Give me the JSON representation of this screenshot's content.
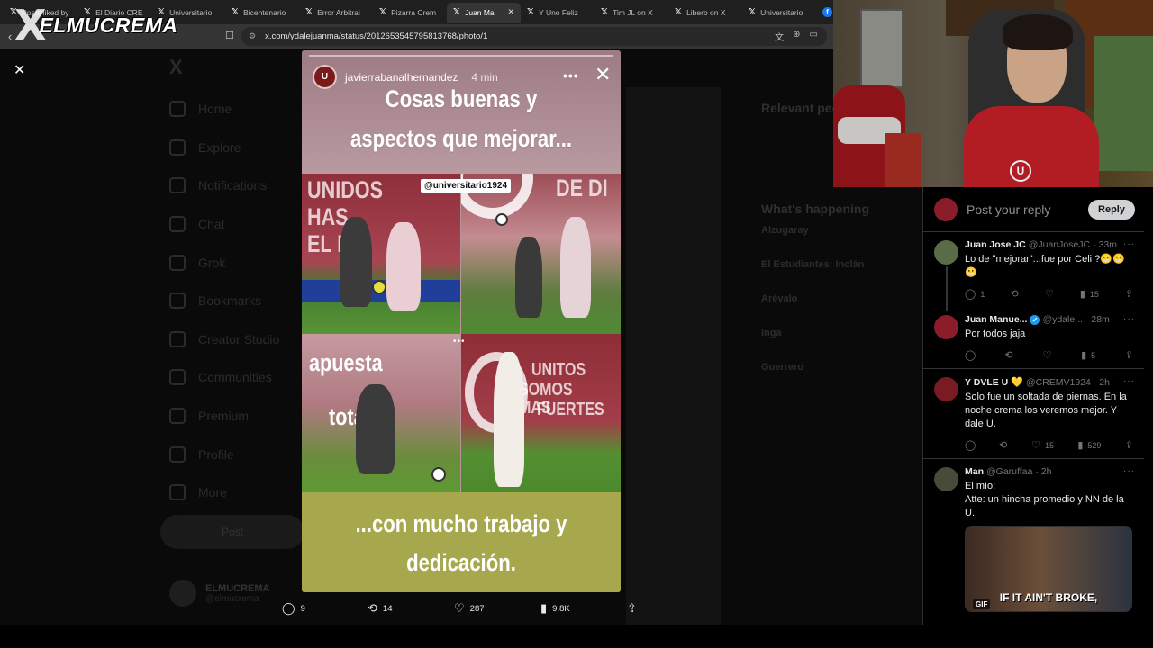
{
  "watermark": {
    "mark": "X",
    "text": "ELMUCREMA"
  },
  "browser": {
    "tabs": [
      {
        "icon": "x-logo-icon",
        "title": "Posts liked by",
        "active": false
      },
      {
        "icon": "x-logo-icon",
        "title": "El Diario CRE",
        "active": false
      },
      {
        "icon": "x-logo-icon",
        "title": "Universitario",
        "active": false
      },
      {
        "icon": "x-logo-icon",
        "title": "Bicentenario",
        "active": false
      },
      {
        "icon": "x-logo-icon",
        "title": "Error Arbitral",
        "active": false
      },
      {
        "icon": "x-logo-icon",
        "title": "Pizarra Crem",
        "active": false
      },
      {
        "icon": "x-logo-icon",
        "title": "Juan Ma",
        "active": true,
        "close": "✕"
      },
      {
        "icon": "x-logo-icon",
        "title": "Y Uno Feliz",
        "active": false
      },
      {
        "icon": "x-logo-icon",
        "title": "Tim JL on X",
        "active": false
      },
      {
        "icon": "x-logo-icon",
        "title": "Libero on X",
        "active": false
      },
      {
        "icon": "x-logo-icon",
        "title": "Universitario",
        "active": false
      },
      {
        "icon": "facebook-icon",
        "title": "F",
        "active": false
      }
    ],
    "back_glyph": "‹",
    "url": "x.com/ydalejuanma/status/2012653545795813768/photo/1"
  },
  "left_nav": {
    "logo": "X",
    "items": [
      "Home",
      "Explore",
      "Notifications",
      "Chat",
      "Grok",
      "Bookmarks",
      "Creator Studio",
      "Communities",
      "Premium",
      "Profile",
      "More"
    ],
    "post_button": "Post",
    "account_name": "ELMUCREMA",
    "account_handle": "@elmucrema"
  },
  "right_bg": {
    "relevant": "Relevant people",
    "happening": "What's happening",
    "trends": [
      "Alzugaray",
      "El Estudiantes: Inclán",
      "Arévalo",
      "Inga",
      "Guerrero"
    ]
  },
  "media": {
    "close_glyph": "✕",
    "story": {
      "username": "javierrabanalhernandez",
      "time": "4 min",
      "more_glyph": "•••",
      "close_glyph": "✕",
      "title_line1": "Cosas buenas y",
      "title_line2": "aspectos que mejorar...",
      "tag": "@universitario1924",
      "wall_texts": [
        "UNIDOS",
        "HAS",
        "EL FI",
        "DE DI",
        "apuesta",
        "total",
        "UNITOS",
        "SOMOS MAS",
        "FUERTES"
      ],
      "pager": "•••",
      "subtitle_line1": "...con mucho trabajo y",
      "subtitle_line2": "dedicación."
    },
    "actions": {
      "replies": "9",
      "reposts": "14",
      "likes": "287",
      "views": "9.8K"
    }
  },
  "replies_panel": {
    "placeholder": "Post your reply",
    "reply_button": "Reply",
    "tweets": [
      {
        "name": "Juan Jose JC",
        "handle": "@JuanJoseJC",
        "time": "· 33m",
        "body": "Lo de \"mejorar\"...fue por Celi ?😬😬😬",
        "replies": "1",
        "reposts": "",
        "likes": "",
        "views": "15",
        "avatar_color": "#5a6b48"
      },
      {
        "name": "Juan Manue...",
        "handle": "@ydale...",
        "time": "· 28m",
        "verified": "✔",
        "body": "Por todos jaja",
        "replies": "",
        "reposts": "",
        "likes": "",
        "views": "5",
        "avatar_color": "#8b1d2b"
      },
      {
        "name": "Y DVLE U",
        "handle": "@CREMV1924",
        "time": "· 2h",
        "heart": "💛",
        "body": "Solo fue un soltada de piernas. En la noche crema los veremos mejor. Y dale U.",
        "replies": "",
        "reposts": "",
        "likes": "15",
        "views": "529",
        "avatar_color": "#7a1a22"
      },
      {
        "name": "Man",
        "handle": "@Garuffaa",
        "time": "· 2h",
        "body_line1": "El mío:",
        "body_line2": "Atte: un hincha promedio y NN de la U.",
        "gif_caption": "IF IT AIN'T BROKE,",
        "gif_label": "GIF",
        "avatar_color": "#4a4a3a"
      }
    ],
    "more_glyph": "···"
  },
  "webcam": {
    "logo_letter": "U"
  }
}
